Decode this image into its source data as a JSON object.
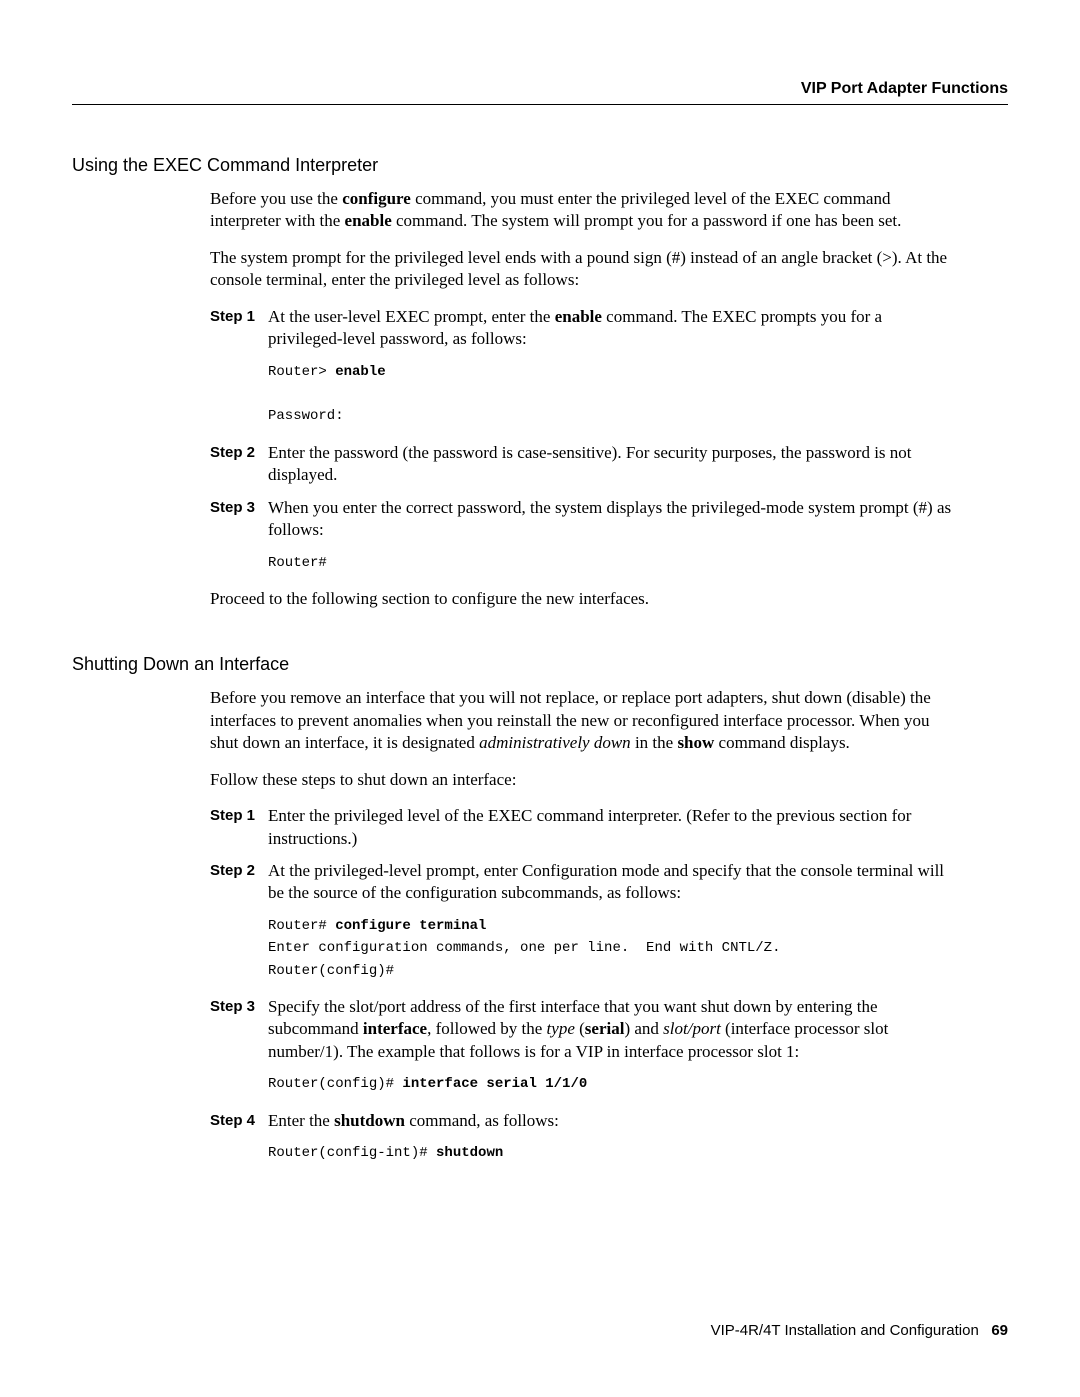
{
  "header": {
    "rightTitle": "VIP Port Adapter Functions"
  },
  "section1": {
    "heading": "Using the EXEC Command Interpreter",
    "p1_a": "Before you use the ",
    "p1_b": "configure",
    "p1_c": " command, you must enter the privileged level of the EXEC command interpreter with the ",
    "p1_d": "enable",
    "p1_e": " command. The system will prompt you for a password if one has been set.",
    "p2": "The system prompt for the privileged level ends with a pound sign (#) instead of an angle bracket (>). At the console terminal, enter the privileged level as follows:",
    "step1": {
      "label": "Step 1",
      "a": "At the user-level EXEC prompt, enter the ",
      "b": "enable",
      "c": " command. The EXEC prompts you for a privileged-level password, as follows:"
    },
    "code1_line1_a": "Router> ",
    "code1_line1_b": "enable",
    "code1_line2": "Password:",
    "step2": {
      "label": "Step 2",
      "text": "Enter the password (the password is case-sensitive). For security purposes, the password is not displayed."
    },
    "step3": {
      "label": "Step 3",
      "text": "When you enter the correct password, the system displays the privileged-mode system prompt (#) as follows:"
    },
    "code2": "Router#",
    "p3": "Proceed to the following section to configure the new interfaces."
  },
  "section2": {
    "heading": "Shutting Down an Interface",
    "p1_a": "Before you remove an interface that you will not replace, or replace port adapters, shut down (disable) the interfaces to prevent anomalies when you reinstall the new or reconfigured interface processor. When you shut down an interface, it is designated ",
    "p1_b": "administratively down",
    "p1_c": " in the ",
    "p1_d": "show",
    "p1_e": " command displays.",
    "p2": "Follow these steps to shut down an interface:",
    "step1": {
      "label": "Step 1",
      "text": "Enter the privileged level of the EXEC command interpreter. (Refer to the previous section for instructions.)"
    },
    "step2": {
      "label": "Step 2",
      "text": "At the privileged-level prompt, enter Configuration mode and specify that the console terminal will be the source of the configuration subcommands, as follows:"
    },
    "code1_line1_a": "Router# ",
    "code1_line1_b": "configure terminal",
    "code1_line2": "Enter configuration commands, one per line.  End with CNTL/Z.",
    "code1_line3": "Router(config)#",
    "step3": {
      "label": "Step 3",
      "a": "Specify the slot/port address of the first interface that you want shut down by entering the subcommand ",
      "b": "interface",
      "c": ", followed by the ",
      "d": "type",
      "e": " (",
      "f": "serial",
      "g": ") and ",
      "h": "slot/port",
      "i": " (interface processor slot number/1). The example that follows is for a VIP in interface processor slot 1:"
    },
    "code2_a": "Router(config)# ",
    "code2_b": "interface serial 1/1/0",
    "step4": {
      "label": "Step 4",
      "a": "Enter the ",
      "b": "shutdown",
      "c": " command, as follows:"
    },
    "code3_a": "Router(config-int)# ",
    "code3_b": "shutdown"
  },
  "footer": {
    "text": "VIP-4R/4T Installation and Configuration",
    "page": "69"
  }
}
